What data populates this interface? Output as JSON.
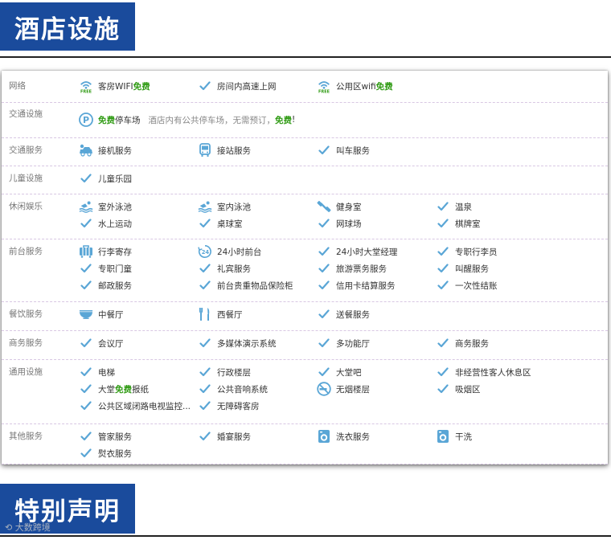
{
  "headers": {
    "facilities_title": "酒店设施",
    "notice_title": "特别声明"
  },
  "colors": {
    "header_bg": "#1a4b9c",
    "accent_blue": "#5aa6d6",
    "free_green": "#2e9a12",
    "separator": "#d8c7e3"
  },
  "sections": [
    {
      "label": "网络",
      "items": [
        {
          "icon": "wifi-free-icon",
          "parts": [
            {
              "text": "客房WIFI"
            },
            {
              "text": "免费",
              "hl": true
            }
          ]
        },
        {
          "icon": "check-icon",
          "parts": [
            {
              "text": "房间内高速上网"
            }
          ]
        },
        {
          "icon": "wifi-free-icon",
          "parts": [
            {
              "text": "公用区wifi"
            },
            {
              "text": "免费",
              "hl": true
            }
          ]
        }
      ]
    },
    {
      "label": "交通设施",
      "items": [
        {
          "icon": "parking-icon",
          "parts": [
            {
              "text": "免费",
              "hl": true
            },
            {
              "text": "停车场"
            },
            {
              "text": "   酒店内有公共停车场，无需预订，"
            },
            {
              "text": "免费",
              "hl": true
            },
            {
              "text": "!"
            }
          ]
        }
      ]
    },
    {
      "label": "交通服务",
      "items": [
        {
          "icon": "car-icon",
          "parts": [
            {
              "text": "接机服务"
            }
          ]
        },
        {
          "icon": "bus-icon",
          "parts": [
            {
              "text": "接站服务"
            }
          ]
        },
        {
          "icon": "check-icon",
          "parts": [
            {
              "text": "叫车服务"
            }
          ]
        }
      ]
    },
    {
      "label": "儿童设施",
      "items": [
        {
          "icon": "check-icon",
          "parts": [
            {
              "text": "儿童乐园"
            }
          ]
        }
      ]
    },
    {
      "label": "休闲娱乐",
      "items": [
        {
          "icon": "swimming-icon",
          "parts": [
            {
              "text": "室外泳池"
            }
          ]
        },
        {
          "icon": "swimming-icon",
          "parts": [
            {
              "text": "室内泳池"
            }
          ]
        },
        {
          "icon": "fitness-icon",
          "parts": [
            {
              "text": "健身室"
            }
          ]
        },
        {
          "icon": "check-icon",
          "parts": [
            {
              "text": "温泉"
            }
          ]
        },
        {
          "icon": "check-icon",
          "parts": [
            {
              "text": "水上运动"
            }
          ]
        },
        {
          "icon": "check-icon",
          "parts": [
            {
              "text": "桌球室"
            }
          ]
        },
        {
          "icon": "check-icon",
          "parts": [
            {
              "text": "网球场"
            }
          ]
        },
        {
          "icon": "check-icon",
          "parts": [
            {
              "text": "棋牌室"
            }
          ]
        }
      ]
    },
    {
      "label": "前台服务",
      "items": [
        {
          "icon": "luggage-icon",
          "parts": [
            {
              "text": "行李寄存"
            }
          ]
        },
        {
          "icon": "clock-24-icon",
          "parts": [
            {
              "text": "24小时前台"
            }
          ]
        },
        {
          "icon": "check-icon",
          "parts": [
            {
              "text": "24小时大堂经理"
            }
          ]
        },
        {
          "icon": "check-icon",
          "parts": [
            {
              "text": "专职行李员"
            }
          ]
        },
        {
          "icon": "check-icon",
          "parts": [
            {
              "text": "专职门童"
            }
          ]
        },
        {
          "icon": "check-icon",
          "parts": [
            {
              "text": "礼宾服务"
            }
          ]
        },
        {
          "icon": "check-icon",
          "parts": [
            {
              "text": "旅游票务服务"
            }
          ]
        },
        {
          "icon": "check-icon",
          "parts": [
            {
              "text": "叫醒服务"
            }
          ]
        },
        {
          "icon": "check-icon",
          "parts": [
            {
              "text": "邮政服务"
            }
          ]
        },
        {
          "icon": "check-icon",
          "parts": [
            {
              "text": "前台贵重物品保险柜"
            }
          ]
        },
        {
          "icon": "check-icon",
          "parts": [
            {
              "text": "信用卡结算服务"
            }
          ]
        },
        {
          "icon": "check-icon",
          "parts": [
            {
              "text": "一次性结账"
            }
          ]
        }
      ]
    },
    {
      "label": "餐饮服务",
      "items": [
        {
          "icon": "bowl-icon",
          "parts": [
            {
              "text": "中餐厅"
            }
          ]
        },
        {
          "icon": "cutlery-icon",
          "parts": [
            {
              "text": "西餐厅"
            }
          ]
        },
        {
          "icon": "check-icon",
          "parts": [
            {
              "text": "送餐服务"
            }
          ]
        }
      ]
    },
    {
      "label": "商务服务",
      "items": [
        {
          "icon": "check-icon",
          "parts": [
            {
              "text": "会议厅"
            }
          ]
        },
        {
          "icon": "check-icon",
          "parts": [
            {
              "text": "多媒体演示系统"
            }
          ]
        },
        {
          "icon": "check-icon",
          "parts": [
            {
              "text": "多功能厅"
            }
          ]
        },
        {
          "icon": "check-icon",
          "parts": [
            {
              "text": "商务服务"
            }
          ]
        }
      ]
    },
    {
      "label": "通用设施",
      "items": [
        {
          "icon": "check-icon",
          "parts": [
            {
              "text": "电梯"
            }
          ]
        },
        {
          "icon": "check-icon",
          "parts": [
            {
              "text": "行政楼层"
            }
          ]
        },
        {
          "icon": "check-icon",
          "parts": [
            {
              "text": "大堂吧"
            }
          ]
        },
        {
          "icon": "check-icon",
          "parts": [
            {
              "text": "非经营性客人休息区"
            }
          ]
        },
        {
          "icon": "check-icon",
          "parts": [
            {
              "text": "大堂"
            },
            {
              "text": "免费",
              "hl": true
            },
            {
              "text": "报纸"
            }
          ]
        },
        {
          "icon": "check-icon",
          "parts": [
            {
              "text": "公共音响系统"
            }
          ]
        },
        {
          "icon": "no-smoking-icon",
          "parts": [
            {
              "text": "无烟楼层"
            }
          ]
        },
        {
          "icon": "check-icon",
          "parts": [
            {
              "text": "吸烟区"
            }
          ]
        },
        {
          "icon": "check-icon",
          "parts": [
            {
              "text": "公共区域闭路电视监控..."
            }
          ]
        },
        {
          "icon": "check-icon",
          "parts": [
            {
              "text": "无障碍客房"
            }
          ]
        }
      ]
    },
    {
      "label": "其他服务",
      "items": [
        {
          "icon": "check-icon",
          "parts": [
            {
              "text": "管家服务"
            }
          ]
        },
        {
          "icon": "check-icon",
          "parts": [
            {
              "text": "婚宴服务"
            }
          ]
        },
        {
          "icon": "washer-icon",
          "parts": [
            {
              "text": "洗衣服务"
            }
          ]
        },
        {
          "icon": "washer-icon",
          "parts": [
            {
              "text": "干洗"
            }
          ]
        },
        {
          "icon": "check-icon",
          "parts": [
            {
              "text": "熨衣服务"
            }
          ]
        }
      ]
    }
  ],
  "watermark": {
    "text": "大数跨境"
  }
}
